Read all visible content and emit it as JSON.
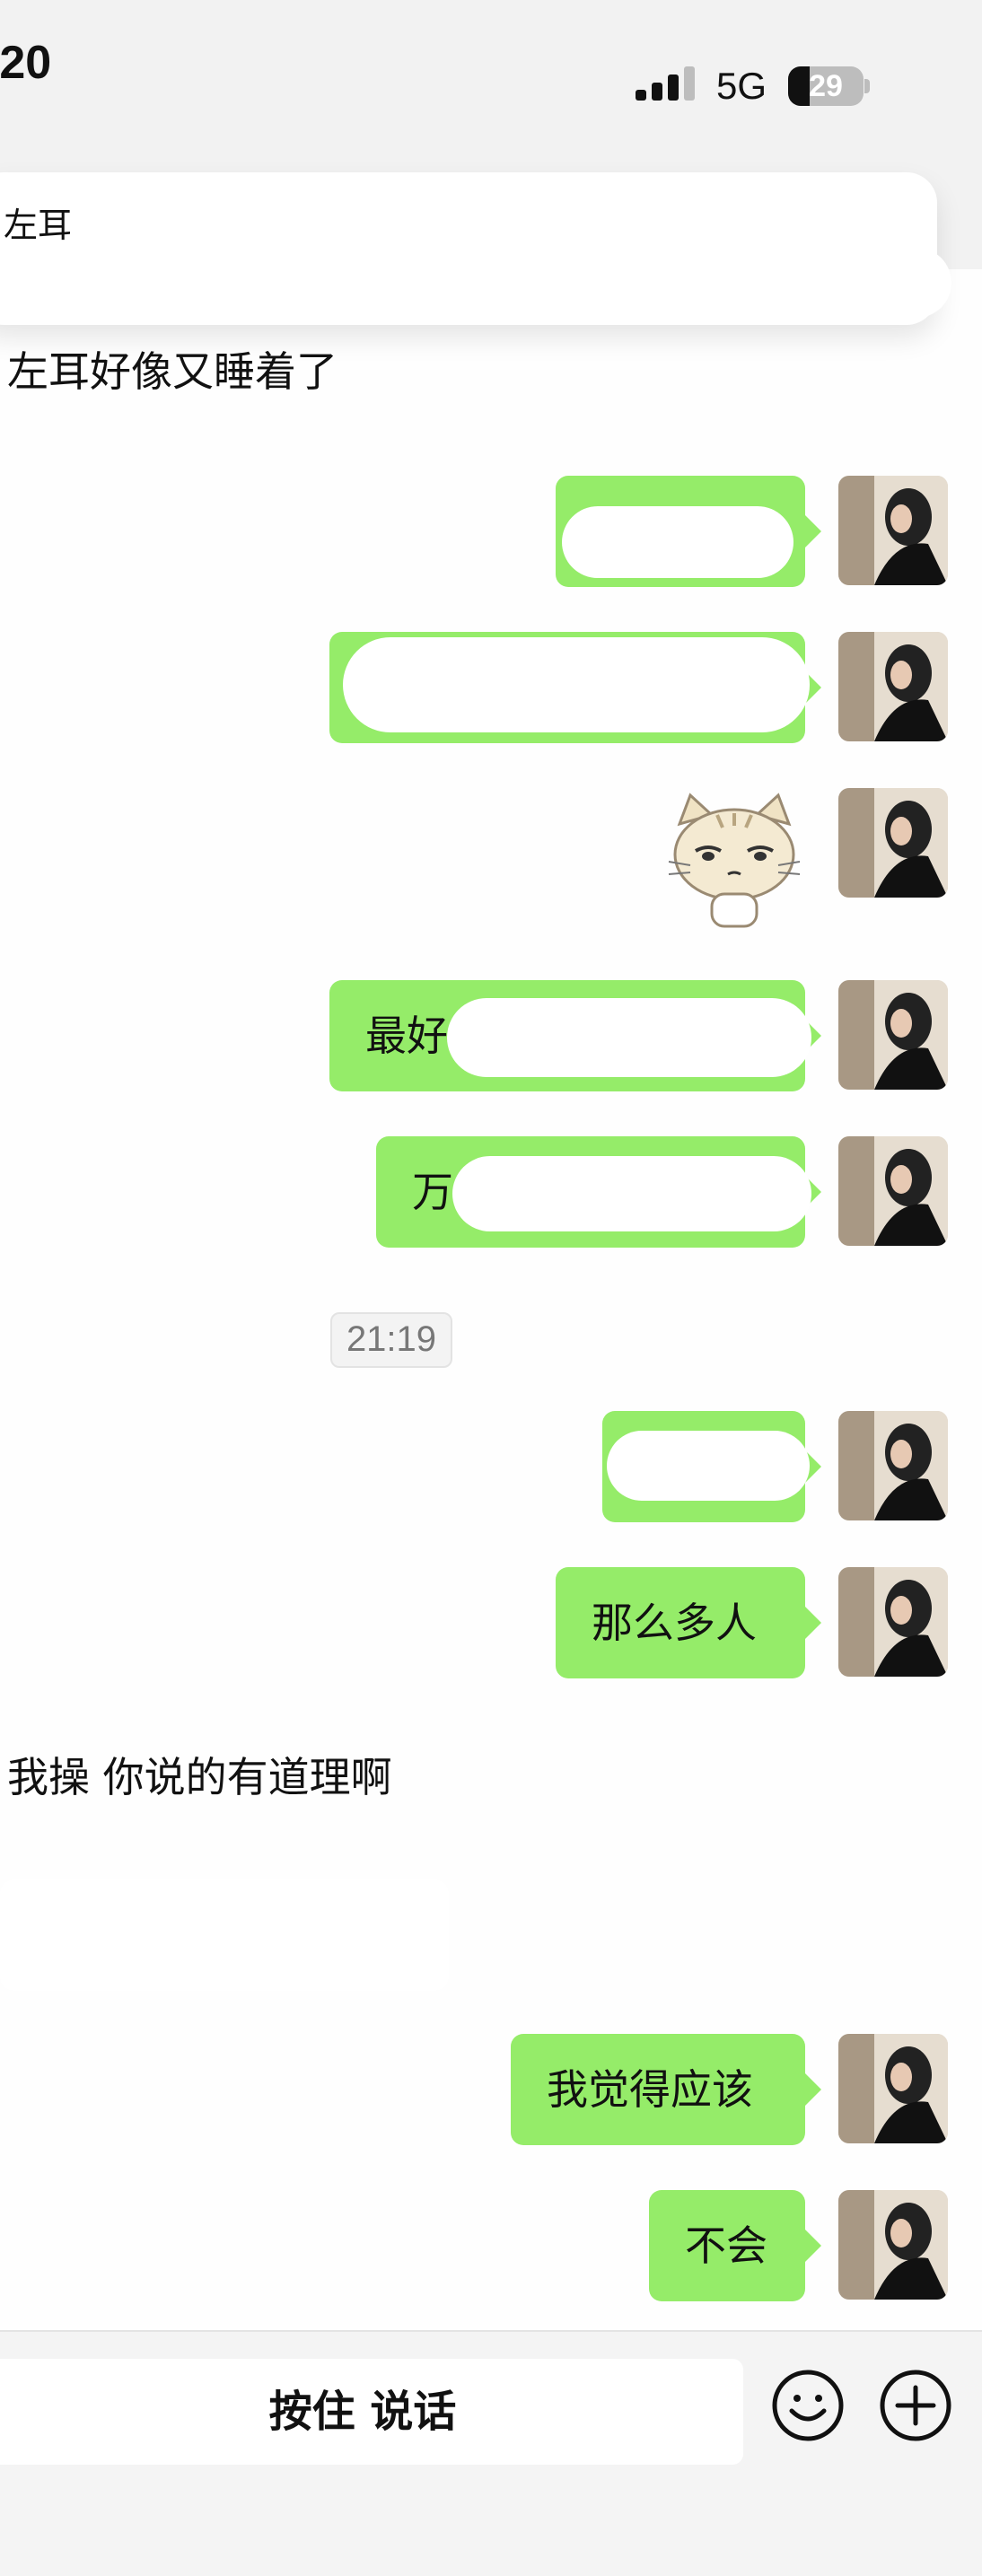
{
  "status_bar": {
    "time": ":20",
    "network": "5G",
    "battery_level": 29,
    "battery_text": "29"
  },
  "notification": {
    "title": "左耳"
  },
  "messages": [
    {
      "side": "left",
      "text": "左耳好像又睡着了"
    },
    {
      "side": "right",
      "text": ""
    },
    {
      "side": "right",
      "text": ""
    },
    {
      "side": "right",
      "type": "sticker",
      "icon": "cat-sticker-icon"
    },
    {
      "side": "right",
      "text": "最好"
    },
    {
      "side": "right",
      "text": "万"
    },
    {
      "side": "right",
      "text": ""
    },
    {
      "side": "right",
      "text": "那么多人"
    },
    {
      "side": "left",
      "text": "我操 你说的有道理啊"
    },
    {
      "side": "left",
      "text": ""
    },
    {
      "side": "right",
      "text": "我觉得应该"
    },
    {
      "side": "right",
      "text": "不会"
    }
  ],
  "timestamp": "21:19",
  "input_bar": {
    "voice_label": "按住 说话",
    "emoji_icon": "emoji-icon",
    "plus_icon": "plus-icon"
  },
  "colors": {
    "outgoing_bubble": "#95ec69",
    "background": "#fefefe"
  }
}
